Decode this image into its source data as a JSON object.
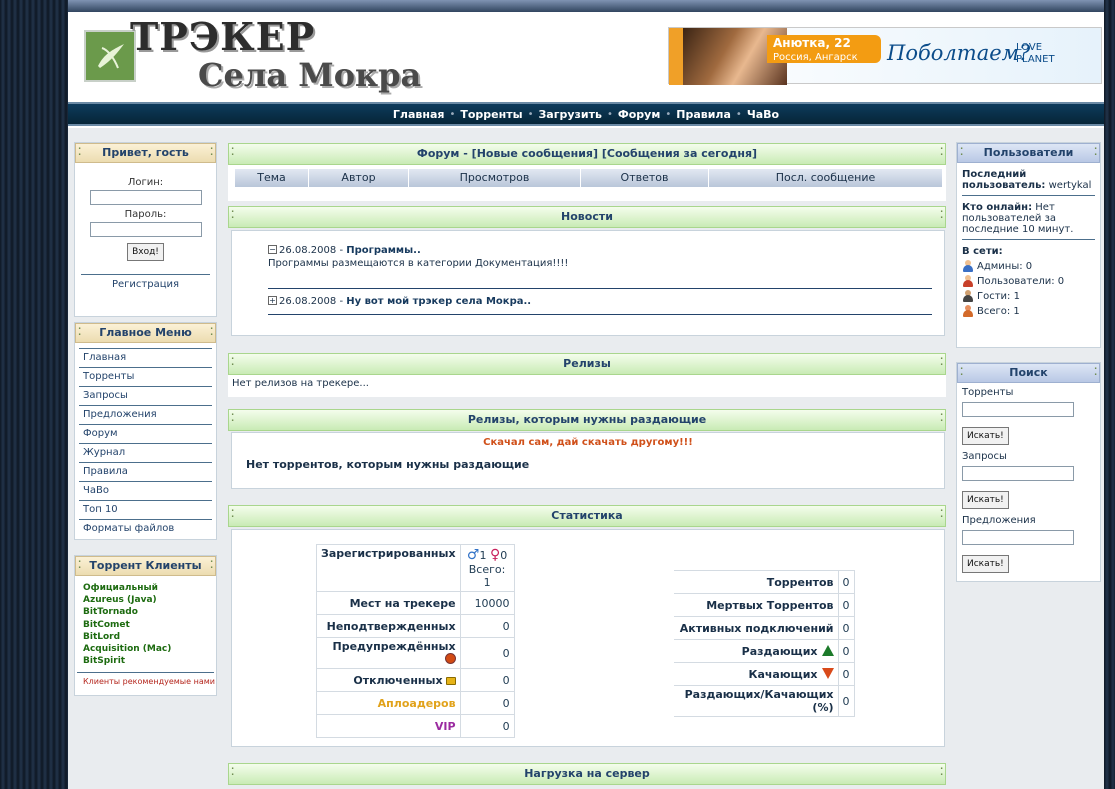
{
  "header": {
    "title_line1": "ТРЭКЕР",
    "title_line2": "Села Мокра",
    "banner": {
      "name": "Анютка, 22",
      "location": "Россия, Ангарск",
      "slogan": "Поболтаем?",
      "brand_line1": "LOVE",
      "brand_line2": "PLANET"
    }
  },
  "nav": [
    "Главная",
    "Торренты",
    "Загрузить",
    "Форум",
    "Правила",
    "ЧаВо"
  ],
  "login": {
    "title": "Привет, гость",
    "login_label": "Логин:",
    "password_label": "Пароль:",
    "login_value": "",
    "password_value": "",
    "submit": "Вход!",
    "register": "Регистрация"
  },
  "main_menu": {
    "title": "Главное Меню",
    "items": [
      "Главная",
      "Торренты",
      "Запросы",
      "Предложения",
      "Форум",
      "Журнал",
      "Правила",
      "ЧаВо",
      "Топ 10",
      "Форматы файлов"
    ]
  },
  "torrent_clients": {
    "title": "Торрент Клиенты",
    "items": [
      "Официальный",
      "Azureus (Java)",
      "BitTornado",
      "BitComet",
      "BitLord",
      "Acquisition (Mac)",
      "BitSpirit"
    ],
    "recommended": "Клиенты рекомендуемые нами"
  },
  "forum": {
    "title": "Форум",
    "link_new": "[Новые сообщения]",
    "link_today": "[Сообщения за сегодня]",
    "columns": [
      "Тема",
      "Автор",
      "Просмотров",
      "Ответов",
      "Посл. сообщение"
    ]
  },
  "news": {
    "title": "Новости",
    "items": [
      {
        "toggle": "−",
        "date": "26.08.2008",
        "headline": "Программы..",
        "body": "Программы размещаются в категории Документация!!!!"
      },
      {
        "toggle": "+",
        "date": "26.08.2008",
        "headline": "Ну вот мой трэкер села Мокра..",
        "body": ""
      }
    ]
  },
  "releases": {
    "title": "Релизы",
    "empty": "Нет релизов на трекере..."
  },
  "need_seeders": {
    "title": "Релизы, которым нужны раздающие",
    "motto": "Скачал сам, дай скачать другому!!!",
    "empty": "Нет торрентов, которым нужны раздающие"
  },
  "stats": {
    "title": "Статистика",
    "registered_label": "Зарегистрированных",
    "male_count": "1",
    "female_count": "0",
    "total": "Всего: 1",
    "places_label": "Мест на трекере",
    "places_value": "10000",
    "left_rows": [
      {
        "label": "Неподтвержденных",
        "value": "0"
      },
      {
        "label": "Предупреждённых",
        "value": "0"
      },
      {
        "label": "Отключенных",
        "value": "0"
      },
      {
        "label": "Аплоадеров",
        "value": "0"
      },
      {
        "label": "VIP",
        "value": "0"
      }
    ],
    "right_rows": [
      {
        "label": "Торрентов",
        "value": "0"
      },
      {
        "label": "Мертвых Торрентов",
        "value": "0"
      },
      {
        "label": "Активных подключений",
        "value": "0"
      },
      {
        "label": "Раздающих",
        "value": "0"
      },
      {
        "label": "Качающих",
        "value": "0"
      },
      {
        "label": "Раздающих/Качающих (%)",
        "value": "0"
      }
    ],
    "colors": {
      "uploaders": "#e1a21a",
      "vip": "#9b2aa0",
      "seeders": "#1c7a2a",
      "leechers": "#d94a1a"
    }
  },
  "server_load": {
    "title": "Нагрузка на сервер"
  },
  "users": {
    "title": "Пользователи",
    "last_user_label": "Последний пользователь:",
    "last_user": "wertykal",
    "online_label": "Кто онлайн:",
    "online_text": "Нет пользователей за последние 10 минут.",
    "network_label": "В сети:",
    "admins": "Админы: 0",
    "members": "Пользователи: 0",
    "guests": "Гости: 1",
    "total": "Всего: 1"
  },
  "search": {
    "title": "Поиск",
    "sections": [
      {
        "label": "Торренты",
        "button": "Искать!",
        "value": ""
      },
      {
        "label": "Запросы",
        "button": "Искать!",
        "value": ""
      },
      {
        "label": "Предложения",
        "button": "Искать!",
        "value": ""
      }
    ]
  }
}
